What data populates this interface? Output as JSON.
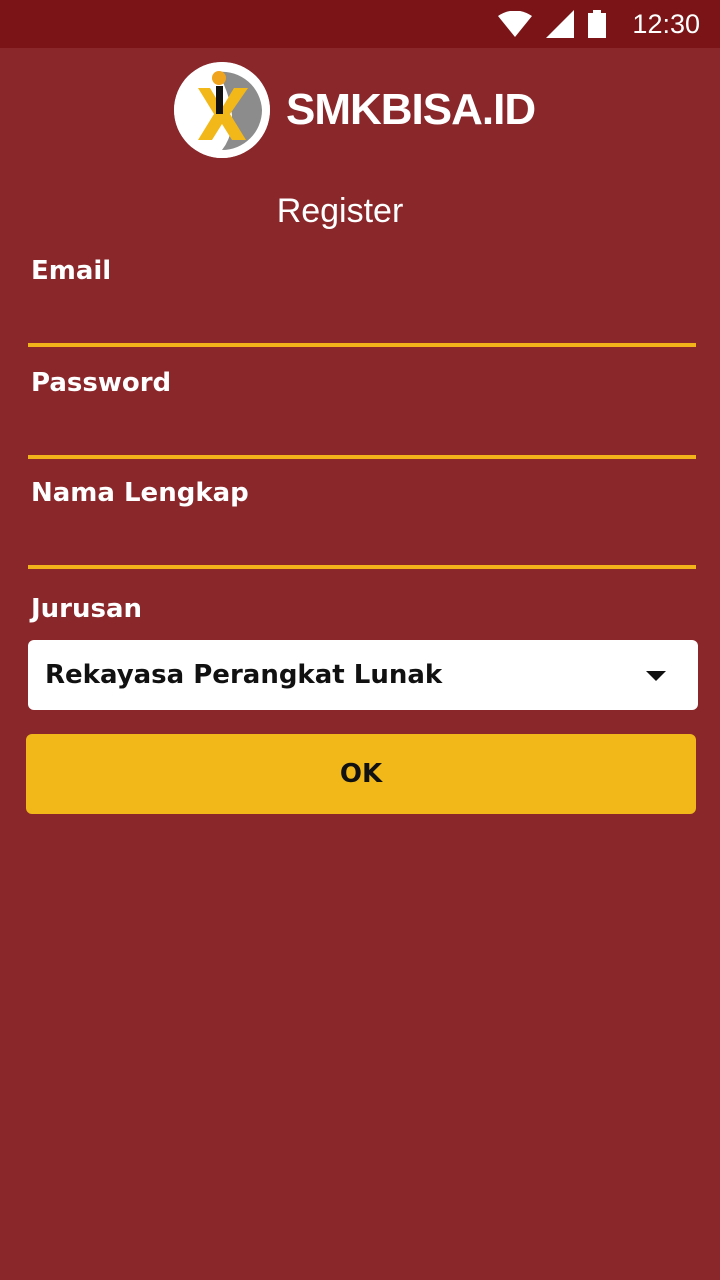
{
  "status_bar": {
    "time": "12:30",
    "icons": [
      "wifi-icon",
      "signal-icon",
      "battery-icon"
    ]
  },
  "brand": {
    "name": "SMKBISA.ID",
    "logo": "smkbisa-logo"
  },
  "page": {
    "title": "Register"
  },
  "form": {
    "email": {
      "label": "Email",
      "value": "",
      "placeholder": ""
    },
    "password": {
      "label": "Password",
      "value": "",
      "placeholder": ""
    },
    "full_name": {
      "label": "Nama Lengkap",
      "value": "",
      "placeholder": ""
    },
    "major": {
      "label": "Jurusan",
      "selected": "Rekayasa Perangkat Lunak"
    },
    "submit_label": "OK"
  },
  "colors": {
    "background": "#8a272b",
    "status_bar": "#7a1416",
    "accent": "#f2b81a",
    "underline": "#f2b21a"
  }
}
